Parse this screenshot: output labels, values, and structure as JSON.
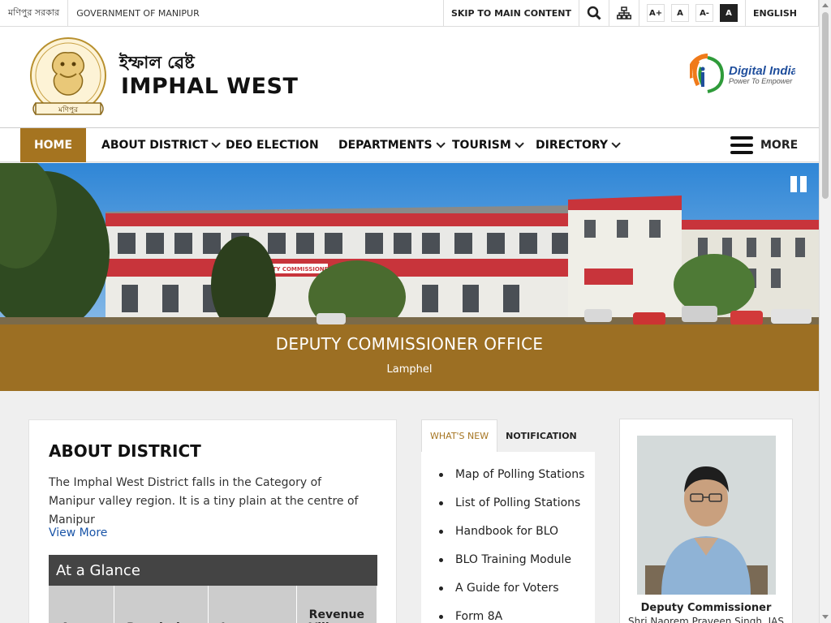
{
  "topbar": {
    "local_gov": "মণিপুর সরকার",
    "gov": "GOVERNMENT OF MANIPUR",
    "skip": "SKIP TO MAIN CONTENT",
    "font_buttons": [
      "A+",
      "A",
      "A-",
      "A"
    ],
    "language": "ENGLISH"
  },
  "header": {
    "title_local": "ইম্ফাল ৱেষ্ট",
    "title": "IMPHAL WEST",
    "emblem_text": "মণিপুর",
    "digital_india": {
      "title": "Digital India",
      "tagline": "Power To Empower"
    }
  },
  "nav": {
    "items": [
      "HOME",
      "ABOUT DISTRICT",
      "DEO ELECTION",
      "DEPARTMENTS",
      "TOURISM",
      "DIRECTORY"
    ],
    "more": "MORE"
  },
  "banner": {
    "title": "DEPUTY COMMISSIONER OFFICE",
    "subtitle": "Lamphel",
    "sign_text": "DEPUTY COMMISSIONER"
  },
  "about": {
    "heading": "ABOUT DISTRICT",
    "text": "The Imphal West District falls in the Category of Manipur valley region. It is a tiny plain at the centre of Manipur",
    "view_more": "View More",
    "glance": {
      "heading": "At a Glance",
      "columns": [
        "Area",
        "Population",
        "Language",
        "Revenue Villages"
      ]
    }
  },
  "news": {
    "tabs": [
      "WHAT'S NEW",
      "NOTIFICATION"
    ],
    "items": [
      "Map of Polling Stations",
      "List of Polling Stations",
      "Handbook for BLO",
      "BLO Training Module",
      "A Guide for Voters",
      "Form 8A"
    ]
  },
  "dc": {
    "role": "Deputy Commissioner",
    "name": "Shri Naorem Praveen Singh, IAS"
  },
  "colors": {
    "accent": "#a57420",
    "link": "#1a55a8",
    "dark": "#444444"
  }
}
